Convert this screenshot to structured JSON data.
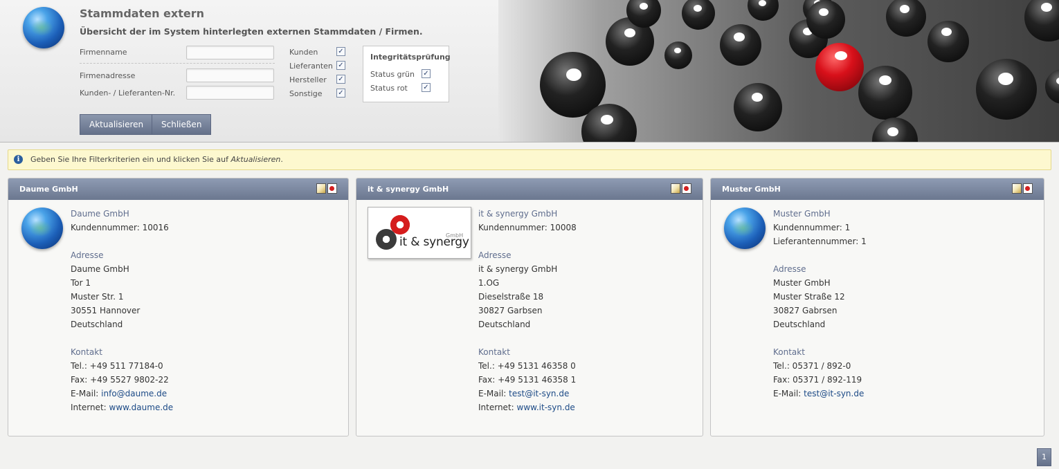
{
  "header": {
    "title": "Stammdaten extern",
    "subtitle": "Übersicht der im System hinterlegten externen Stammdaten / Firmen.",
    "fields": {
      "firmenname": "Firmenname",
      "firmenadresse": "Firmenadresse",
      "nummer": "Kunden- / Lieferanten-Nr."
    },
    "types": {
      "kunden": "Kunden",
      "lieferanten": "Lieferanten",
      "hersteller": "Hersteller",
      "sonstige": "Sonstige"
    },
    "integrity": {
      "title": "Integritätsprüfung",
      "gruen": "Status grün",
      "rot": "Status rot"
    },
    "buttons": {
      "refresh": "Aktualisieren",
      "close": "Schließen"
    },
    "check_mark": "✓"
  },
  "info": {
    "text_before": "Geben Sie Ihre Filterkriterien ein und klicken Sie auf ",
    "text_em": "Aktualisieren",
    "text_after": ".",
    "icon": "i"
  },
  "cards": [
    {
      "header": "Daume GmbH",
      "name": "Daume GmbH",
      "kunden": "Kundennummer: 10016",
      "address_label": "Adresse",
      "address": [
        "Daume GmbH",
        "Tor 1",
        "Muster Str. 1",
        "30551 Hannover",
        "Deutschland"
      ],
      "contact_label": "Kontakt",
      "tel": "Tel.: +49 511 77184-0",
      "fax": "Fax: +49 5527 9802-22",
      "email_label": "E-Mail: ",
      "email": "info@daume.de",
      "web_label": "Internet: ",
      "web": "www.daume.de"
    },
    {
      "header": "it & synergy GmbH",
      "name": "it & synergy GmbH",
      "kunden": "Kundennummer: 10008",
      "address_label": "Adresse",
      "address": [
        "it & synergy GmbH",
        "1.OG",
        "Dieselstraße 18",
        "30827 Garbsen",
        "Deutschland"
      ],
      "contact_label": "Kontakt",
      "tel": "Tel.: +49 5131 46358 0",
      "fax": "Fax: +49 5131 46358 1",
      "email_label": "E-Mail: ",
      "email": "test@it-syn.de",
      "web_label": "Internet: ",
      "web": "www.it-syn.de",
      "logo_text": "it & synergy",
      "logo_gmbh": "GmbH"
    },
    {
      "header": "Muster GmbH",
      "name": "Muster GmbH",
      "kunden": "Kundennummer: 1",
      "lieferant": "Lieferantennummer: 1",
      "address_label": "Adresse",
      "address": [
        "Muster GmbH",
        "Muster Straße 12",
        "30827 Gabrsen",
        "Deutschland"
      ],
      "contact_label": "Kontakt",
      "tel": "Tel.: 05371 / 892-0",
      "fax": "Fax: 05371 / 892-119",
      "email_label": "E-Mail: ",
      "email": "test@it-syn.de"
    }
  ],
  "pager": {
    "page": "1"
  }
}
